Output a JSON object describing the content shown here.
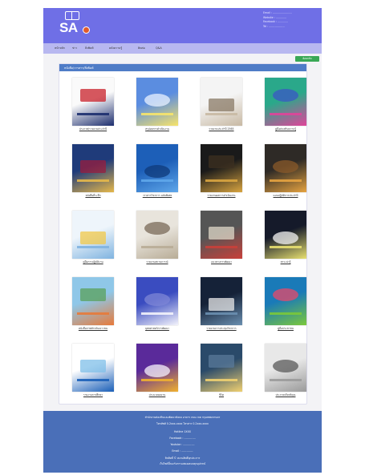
{
  "header": {
    "logo_text": "SA",
    "contact_lines": [
      "Email : ........................",
      "Website : .............",
      "Facebook : .............",
      "Tel : ..................."
    ]
  },
  "nav": {
    "items": [
      "หน้าหลัก",
      "ข่าว",
      "สิ่งพิมพ์",
      "คลังความรู้",
      "ติดต่อ",
      "Q&A"
    ]
  },
  "toolbar": {
    "back_label": "ย้อนกลับ"
  },
  "panel": {
    "title": "หนังสือ/วารสาร/สิ่งพิมพ์"
  },
  "books": [
    {
      "title": "ประกาศ/รายงานประจำปี",
      "palette": [
        "#fafafa",
        "#1c2d6e",
        "#c8202a"
      ]
    },
    {
      "title": "สรุปผลการดำเนินงาน",
      "palette": [
        "#5b8de0",
        "#f7e46a",
        "#e9f1ff"
      ]
    },
    {
      "title": "รายงานประจำปี 2565",
      "palette": [
        "#f4f4f4",
        "#c8b9a3",
        "#8a7a66"
      ]
    },
    {
      "title": "คู่มือส่งเสริมความรู้",
      "palette": [
        "#2aa88a",
        "#e0449a",
        "#3b57c4"
      ]
    },
    {
      "title": "หนังสือที่ระลึก",
      "palette": [
        "#1f3b7a",
        "#e6b84a",
        "#9a1d3e"
      ]
    },
    {
      "title": "วารสารวิชาการ ฉบับพิเศษ",
      "palette": [
        "#1d5fb8",
        "#5fa7ea",
        "#0f3a7a"
      ]
    },
    {
      "title": "รายงานผลการดำเนินงาน",
      "palette": [
        "#1a1a1a",
        "#d9a540",
        "#3d3020"
      ]
    },
    {
      "title": "แผนปฏิบัติการประจำปี",
      "palette": [
        "#2e2a26",
        "#e6a340",
        "#8a5a2a"
      ]
    },
    {
      "title": "คู่มือการปฏิบัติงาน",
      "palette": [
        "#eef5fb",
        "#7fb3e0",
        "#f0c84a"
      ]
    },
    {
      "title": "รายงานสถานการณ์",
      "palette": [
        "#e8e4dc",
        "#b8ac96",
        "#7a6a58"
      ]
    },
    {
      "title": "แนวทางการพัฒนา",
      "palette": [
        "#555",
        "#c9403a",
        "#e0d8c8"
      ]
    },
    {
      "title": "สาระน่ารู้",
      "palette": [
        "#151a2a",
        "#e8e070",
        "#f2f2f2"
      ]
    },
    {
      "title": "หนังสือภาพสำหรับเยาวชน",
      "palette": [
        "#8fc7e8",
        "#e77a3a",
        "#5aa05a"
      ]
    },
    {
      "title": "ยุทธศาสตร์การพัฒนา",
      "palette": [
        "#3a4cc0",
        "#f3f3fb",
        "#7d86d6"
      ]
    },
    {
      "title": "รายงานการประชุมวิชาการ",
      "palette": [
        "#152238",
        "#6a8fb0",
        "#e8e8e8"
      ]
    },
    {
      "title": "คู่มือประชาชน",
      "palette": [
        "#1a7ab8",
        "#7ac83a",
        "#e84a6a"
      ]
    },
    {
      "title": "รายงานการศึกษา",
      "palette": [
        "#ffffff",
        "#1a5fb8",
        "#7fbfe8"
      ]
    },
    {
      "title": "ประมวลผลงาน",
      "palette": [
        "#5a2a9a",
        "#f0b030",
        "#f7f2fb"
      ]
    },
    {
      "title": "ชีวิต",
      "palette": [
        "#2a4a6a",
        "#f0d070",
        "#5a7a9a"
      ]
    },
    {
      "title": "ประกาศเกียรติคุณ",
      "palette": [
        "#e8e8e8",
        "#9a9a9a",
        "#5a5a5a"
      ]
    }
  ],
  "footer": {
    "lines": [
      "สำนักงานส่งเสริมและพัฒนาสังคม อาคาร ถนน เขต กรุงเทพมหานคร",
      "โทรศัพท์ 0-2xxx-xxxx โทรสาร 0-2xxx-xxxx",
      "Hotline 1XXX",
      "Facebook : ..............",
      "Youtube : ..............",
      "Email : ..............",
      "ลิขสิทธิ์ © สงวนสิทธิ์ทุกประการ",
      "เว็บไซต์นี้รองรับการแสดงผลบนทุกอุปกรณ์"
    ]
  }
}
